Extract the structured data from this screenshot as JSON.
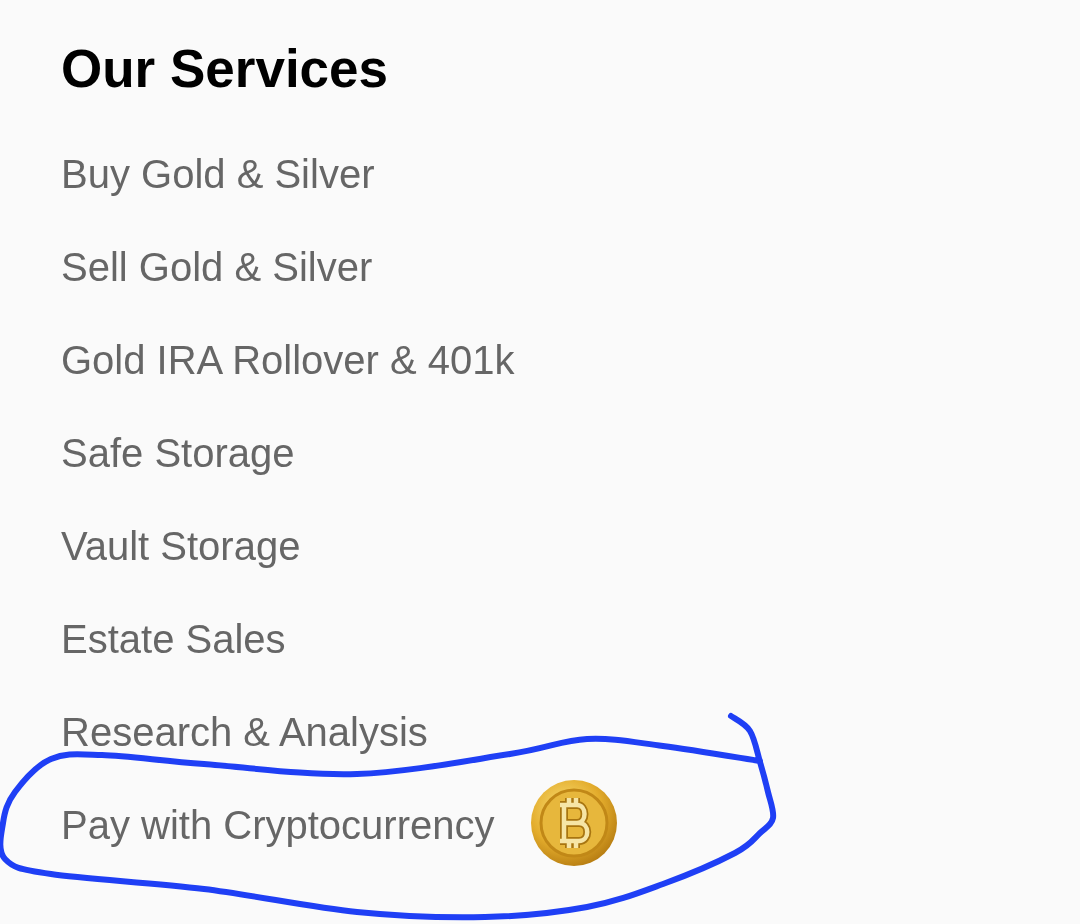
{
  "section": {
    "title": "Our Services"
  },
  "services": [
    {
      "label": "Buy Gold & Silver",
      "kind": "plain",
      "circled": false
    },
    {
      "label": "Sell Gold & Silver",
      "kind": "plain",
      "circled": false
    },
    {
      "label": "Gold IRA Rollover & 401k",
      "kind": "plain",
      "circled": false
    },
    {
      "label": "Safe Storage",
      "kind": "plain",
      "circled": false
    },
    {
      "label": "Vault Storage",
      "kind": "plain",
      "circled": false
    },
    {
      "label": "Estate Sales",
      "kind": "plain",
      "circled": false
    },
    {
      "label": "Research & Analysis",
      "kind": "plain",
      "circled": false
    },
    {
      "label": "Pay with Cryptocurrency",
      "kind": "coin",
      "circled": true
    }
  ]
}
